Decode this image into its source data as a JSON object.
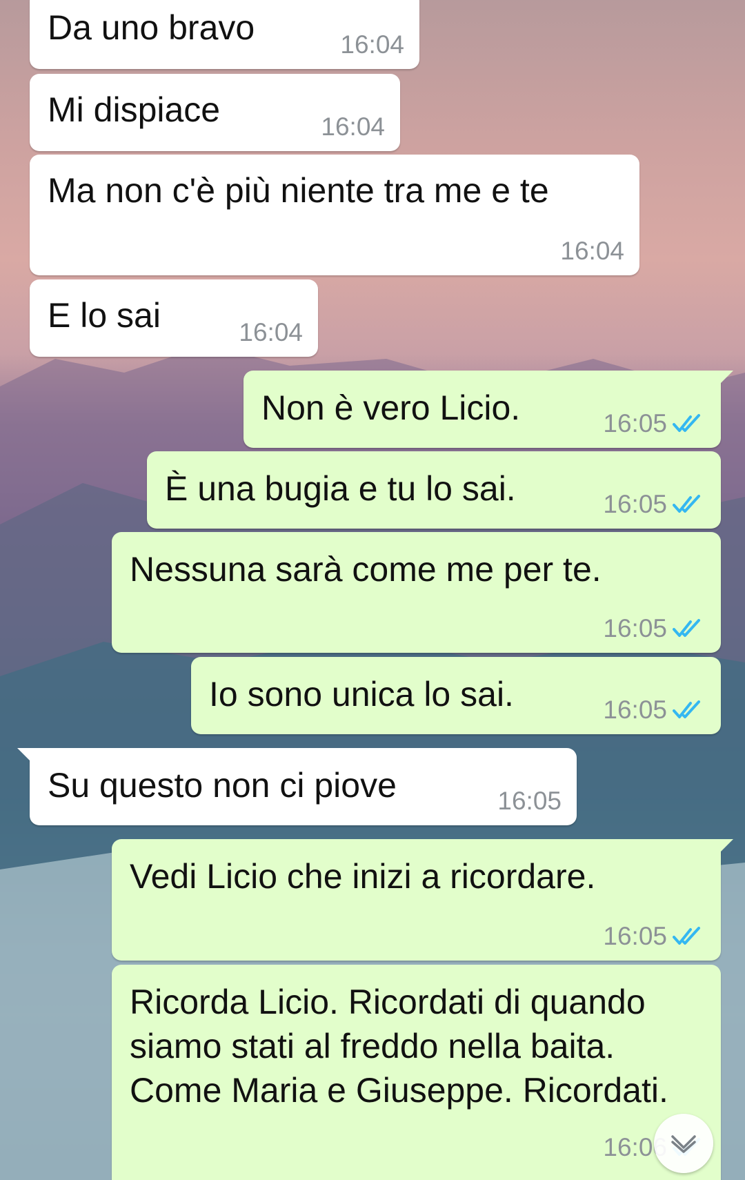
{
  "conversation": {
    "messages": [
      {
        "dir": "in",
        "text": "Da uno bravo",
        "time": "16:04"
      },
      {
        "dir": "in",
        "text": "Mi dispiace",
        "time": "16:04"
      },
      {
        "dir": "in",
        "text": "Ma non c'è più niente tra me e te",
        "time": "16:04"
      },
      {
        "dir": "in",
        "text": "E lo sai",
        "time": "16:04"
      },
      {
        "dir": "out",
        "text": "Non è vero Licio.",
        "time": "16:05",
        "status": "read"
      },
      {
        "dir": "out",
        "text": "È una bugia e tu lo sai.",
        "time": "16:05",
        "status": "read"
      },
      {
        "dir": "out",
        "text": "Nessuna sarà come me per te.",
        "time": "16:05",
        "status": "read"
      },
      {
        "dir": "out",
        "text": "Io sono unica lo sai.",
        "time": "16:05",
        "status": "read"
      },
      {
        "dir": "in",
        "text": "Su questo non ci piove",
        "time": "16:05"
      },
      {
        "dir": "out",
        "text": "Vedi Licio che inizi a ricordare.",
        "time": "16:05",
        "status": "read"
      },
      {
        "dir": "out",
        "text": "Ricorda Licio. Ricordati di quando siamo stati al freddo nella baita. Come Maria e Giuseppe. Ricordati.",
        "time": "16:06",
        "status": "read"
      }
    ]
  },
  "colors": {
    "incoming_bubble": "#ffffff",
    "outgoing_bubble": "#e2fecb",
    "timestamp": "#8c9196",
    "read_ticks": "#34b7f1"
  },
  "icons": {
    "read_receipt": "double-check-icon",
    "scroll_down": "chevron-down-icon"
  }
}
